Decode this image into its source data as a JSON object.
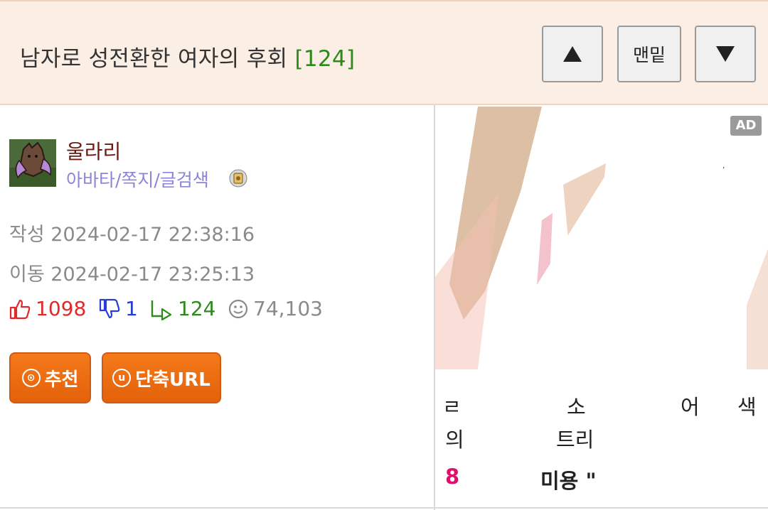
{
  "header": {
    "title": "남자로 성전환한 여자의 후회",
    "comment_count": "[124]",
    "buttons": {
      "up_icon": "up-arrow-icon",
      "bottom_label": "맨밑",
      "down_icon": "down-arrow-icon"
    }
  },
  "author": {
    "name": "울라리",
    "links": "아바타/쪽지/글검색",
    "avatar_icon": "avatar-creature-icon",
    "badge_icon": "badge-icon"
  },
  "meta": {
    "created_label": "작성",
    "created": "2024-02-17 22:38:16",
    "moved_label": "이동",
    "moved": "2024-02-17 23:25:13"
  },
  "stats": {
    "upvotes": "1098",
    "downvotes": "1",
    "replies": "124",
    "views": "74,103"
  },
  "actions": {
    "recommend_label": "추천",
    "short_url_label": "단축URL"
  },
  "ad": {
    "badge": "AD",
    "line1_a": "ㄹ",
    "line1_b": "소",
    "line1_c": "어",
    "line1_d": "색",
    "line2_a": "의",
    "line2_b": "트리",
    "line3_a": "8",
    "line3_b": "미용 \""
  },
  "colors": {
    "header_bg": "#fbeee4",
    "title_count": "#2b8a1a",
    "username": "#6b1a10",
    "links": "#8a86d8",
    "upvote": "#e02a2a",
    "downvote": "#2a3cd6",
    "reply": "#2b8a1a",
    "button_orange": "#f07020"
  }
}
